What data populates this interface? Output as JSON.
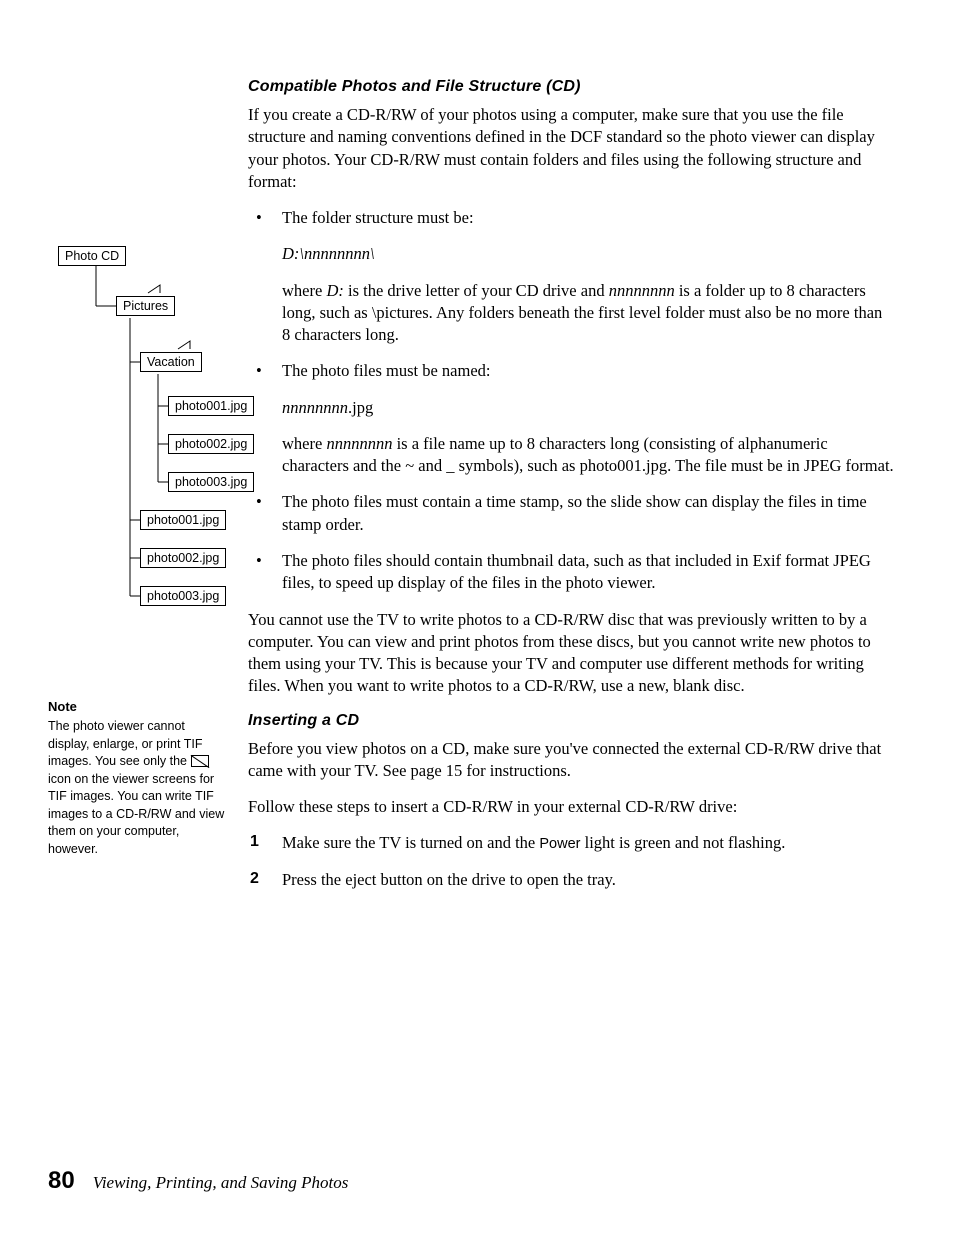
{
  "section1": {
    "title": "Compatible Photos and File Structure (CD)",
    "intro": "If you create a CD-R/RW of your photos using a computer, make sure that you use the file structure and naming conventions defined in the DCF standard so the photo viewer can display your photos. Your CD-R/RW must contain folders and files using the following structure and format:",
    "b1_lead": "The folder structure must be:",
    "b1_code": "D:\\nnnnnnnn\\",
    "b1_expl_a": "where ",
    "b1_expl_b": "D:",
    "b1_expl_c": " is the drive letter of your CD drive and ",
    "b1_expl_d": "nnnnnnnn",
    "b1_expl_e": " is a folder up to 8 characters long, such as \\pictures. Any folders beneath the first level folder must also be no more than 8 characters long.",
    "b2_lead": "The photo files must be named:",
    "b2_code_a": "nnnnnnnn",
    "b2_code_b": ".jpg",
    "b2_expl_a": "where ",
    "b2_expl_b": "nnnnnnnn",
    "b2_expl_c": " is a file name up to 8 characters long (consisting of alphanumeric characters and the ~ and _ symbols), such as photo001.jpg. The file must be in JPEG format.",
    "b3": "The photo files must contain a time stamp, so the slide show can display the files in time stamp order.",
    "b4": "The photo files should contain thumbnail data, such as that included in Exif format JPEG files, to speed up display of the files in the photo viewer.",
    "after": "You cannot use the TV to write photos to a CD-R/RW disc that was previously written to by a computer. You can view and print photos from these discs, but you cannot write new photos to them using your TV. This is because your TV and computer use different methods for writing files. When you want to write photos to a CD-R/RW, use a new, blank disc."
  },
  "section2": {
    "title": "Inserting a CD",
    "p1": "Before you view photos on a CD, make sure you've connected the external CD-R/RW drive that came with your TV. See page 15 for instructions.",
    "p2": "Follow these steps to insert a CD-R/RW in your external CD-R/RW drive:",
    "s1_a": "Make sure the TV is turned on and the ",
    "s1_b": "Power",
    "s1_c": " light is green and not flashing.",
    "s2": "Press the eject button on the drive to open the tray."
  },
  "diagram": {
    "root": "Photo CD",
    "folder1": "Pictures",
    "folder2": "Vacation",
    "f1": "photo001.jpg",
    "f2": "photo002.jpg",
    "f3": "photo003.jpg",
    "f4": "photo001.jpg",
    "f5": "photo002.jpg",
    "f6": "photo003.jpg"
  },
  "note": {
    "title": "Note",
    "body_a": "The photo viewer cannot display, enlarge, or print TIF images. You see only the ",
    "body_b": " icon on the viewer screens for TIF images. You can write TIF images to a CD-R/RW and view them on your computer, however."
  },
  "footer": {
    "page": "80",
    "chapter": "Viewing, Printing, and Saving Photos"
  }
}
